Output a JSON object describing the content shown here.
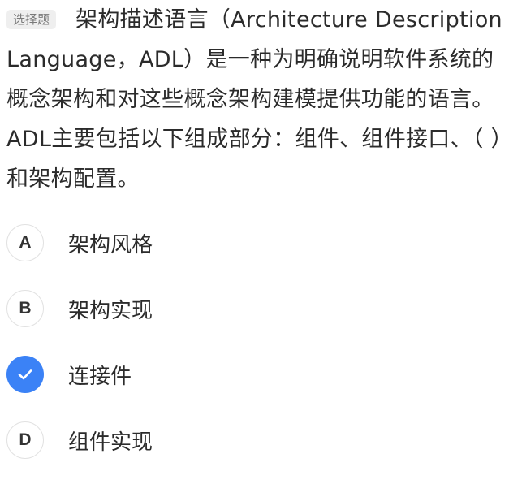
{
  "question": {
    "type_tag": "选择题",
    "text": "架构描述语言（Architecture Description Language，ADL）是一种为明确说明软件系统的概念架构和对这些概念架构建模提供功能的语言。ADL主要包括以下组成部分：组件、组件接口、（ ）和架构配置。"
  },
  "options": [
    {
      "letter": "A",
      "text": "架构风格",
      "selected": false
    },
    {
      "letter": "B",
      "text": "架构实现",
      "selected": false
    },
    {
      "letter": "C",
      "text": "连接件",
      "selected": true
    },
    {
      "letter": "D",
      "text": "组件实现",
      "selected": false
    }
  ],
  "colors": {
    "accent": "#3b82f6",
    "tag_background": "#efefef",
    "badge_border": "#e2e2e2"
  },
  "icons": {
    "selected": "checkmark-icon"
  }
}
